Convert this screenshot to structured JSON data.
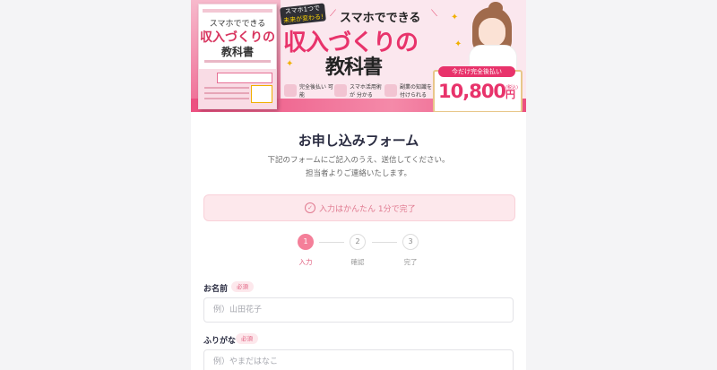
{
  "banner": {
    "sp_tag_line1": "スマホ1つで",
    "sp_tag_line2": "未来が変わる!",
    "headline_small": "スマホでできる",
    "headline_main": "収入づくりの",
    "headline_sub": "教科書",
    "book": {
      "title1": "スマホでできる",
      "title2": "収入づくりの",
      "title3": "教科書"
    },
    "features": [
      {
        "text": "完全後払い 可能",
        "icon": "check-badge-icon"
      },
      {
        "text": "スマホ活用術が 分かる",
        "icon": "phone-icon"
      },
      {
        "text": "副業の知識を 付けられる",
        "icon": "book-icon"
      }
    ],
    "price": {
      "label": "今だけ完全後払い",
      "amount": "10,800",
      "currency": "円",
      "tax": "(税込)"
    }
  },
  "form": {
    "title": "お申し込みフォーム",
    "desc_line1": "下記のフォームにご記入のうえ、送信してください。",
    "desc_line2": "担当者よりご連絡いたします。",
    "notice": "入力はかんたん 1分で完了",
    "steps": [
      {
        "num": "1",
        "label": "入力",
        "active": true
      },
      {
        "num": "2",
        "label": "確認",
        "active": false
      },
      {
        "num": "3",
        "label": "完了",
        "active": false
      }
    ],
    "fields": {
      "name": {
        "label": "お名前",
        "required": "必須",
        "placeholder": "例）山田花子"
      },
      "kana": {
        "label": "ふりがな",
        "required": "必須",
        "placeholder": "例）やまだはなこ"
      }
    }
  },
  "colors": {
    "accent": "#e8336b",
    "step_active": "#f47f99",
    "notice_bg": "#fde8ec",
    "title": "#2b2d42"
  }
}
